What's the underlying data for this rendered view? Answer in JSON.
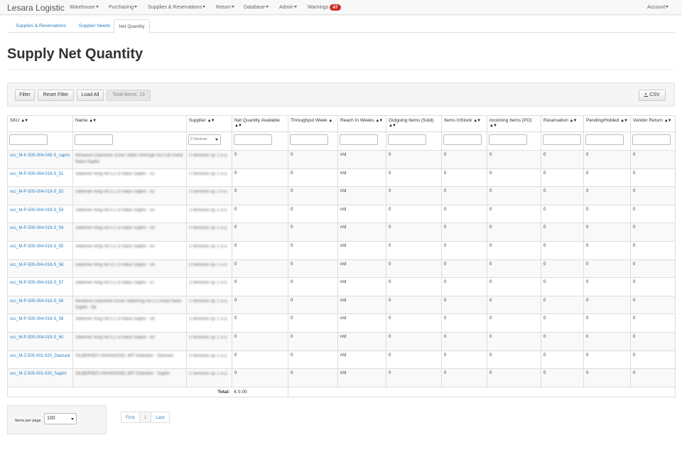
{
  "app": {
    "brand": "Lesara Logistic",
    "nav": [
      {
        "label": "Warehouse"
      },
      {
        "label": "Purchasing"
      },
      {
        "label": "Supplies & Reservations"
      },
      {
        "label": "Return"
      },
      {
        "label": "Database"
      },
      {
        "label": "Admin"
      }
    ],
    "warnings_label": "Warnings",
    "warnings_count": "47",
    "account_label": "Account",
    "badge_color": "#c9302c",
    "link_color": "#2a7fc2"
  },
  "tabs": [
    {
      "label": "Supplies & Reservations",
      "active": false
    },
    {
      "label": "Supplier Needs",
      "active": false
    },
    {
      "label": "Net Quantity",
      "active": true
    }
  ],
  "page": {
    "title": "Supply Net Quantity"
  },
  "toolbar": {
    "filter": "Filter",
    "reset": "Reset Filter",
    "load_all": "Load All",
    "total_items": "Total Items: 13",
    "csv": "CSV",
    "csv_icon": "download-icon"
  },
  "table": {
    "columns": [
      {
        "label": "SKU",
        "sort": "▲▼"
      },
      {
        "label": "Name",
        "sort": "▲▼"
      },
      {
        "label": "Supplier",
        "sort": "▲▼"
      },
      {
        "label": "Net Quantity Available",
        "sort": "▲▼"
      },
      {
        "label": "Throughput Week",
        "sort": "▲"
      },
      {
        "label": "Reach In Weeks",
        "sort": "▲▼"
      },
      {
        "label": "Outgoing Items (Sold)",
        "sort": "▲▼"
      },
      {
        "label": "Items InStock",
        "sort": "▲▼"
      },
      {
        "label": "Incoming Items (PO)",
        "sort": "▲▼"
      },
      {
        "label": "Reservation",
        "sort": "▲▼"
      },
      {
        "label": "Pending/Holded",
        "sort": "▲▼"
      },
      {
        "label": "Vendor Return",
        "sort": "▲▼"
      }
    ],
    "supplier_filter": "3 Venture",
    "rows": [
      {
        "sku": "vcc_M-K-505-004-045-S_capric",
        "name": "Miniature Diamonds 925er Silber Ohrringe mit 0,40 Karat Natur-Saphir",
        "supplier": "3 Ventures sp. z o.o.",
        "values": [
          "0",
          "0",
          "n/d",
          "0",
          "0",
          "0",
          "0",
          "0",
          "0"
        ]
      },
      {
        "sku": "vcc_M-P-505-004-019-S_51",
        "name": "Silberner Ring mit 0,1 ct Natur-Saphir - 51",
        "supplier": "3 Ventures sp. z o.o.",
        "values": [
          "0",
          "0",
          "n/d",
          "0",
          "0",
          "0",
          "0",
          "0",
          "0"
        ]
      },
      {
        "sku": "vcc_M-P-505-004-019-S_52",
        "name": "Silberner Ring mit 0,1 ct Natur-Saphir - 52",
        "supplier": "3 Ventures sp. z o.o.",
        "values": [
          "0",
          "0",
          "n/d",
          "0",
          "0",
          "0",
          "0",
          "0",
          "0"
        ]
      },
      {
        "sku": "vcc_M-P-505-004-019-S_53",
        "name": "Silberner Ring mit 0,1 ct Natur-Saphir - 53",
        "supplier": "3 Ventures sp. z o.o.",
        "values": [
          "0",
          "0",
          "n/d",
          "0",
          "0",
          "0",
          "0",
          "0",
          "0"
        ]
      },
      {
        "sku": "vcc_M-P-505-004-019-S_54",
        "name": "Silberner Ring mit 0,1 ct Natur-Saphir - 54",
        "supplier": "3 Ventures sp. z o.o.",
        "values": [
          "0",
          "0",
          "n/d",
          "0",
          "0",
          "0",
          "0",
          "0",
          "0"
        ]
      },
      {
        "sku": "vcc_M-P-505-004-019-S_55",
        "name": "Silberner Ring mit 0,1 ct Natur-Saphir - 55",
        "supplier": "3 Ventures sp. z o.o.",
        "values": [
          "0",
          "0",
          "n/d",
          "0",
          "0",
          "0",
          "0",
          "0",
          "0"
        ]
      },
      {
        "sku": "vcc_M-P-505-004-019-S_56",
        "name": "Silberner Ring mit 0,1 ct Natur-Saphir - 56",
        "supplier": "3 Ventures sp. z o.o.",
        "values": [
          "0",
          "0",
          "n/d",
          "0",
          "0",
          "0",
          "0",
          "0",
          "0"
        ]
      },
      {
        "sku": "vcc_M-P-505-004-019-S_57",
        "name": "Silberner Ring mit 0,1 ct Natur-Saphir - 57",
        "supplier": "3 Ventures sp. z o.o.",
        "values": [
          "0",
          "0",
          "n/d",
          "0",
          "0",
          "0",
          "0",
          "0",
          "0"
        ]
      },
      {
        "sku": "vcc_M-P-505-004-019-S_58",
        "name": "Miniature Diamonds 925er Silberring mit 0,1 Karat Natur-Saphir - 58",
        "supplier": "3 Ventures sp. z o.o.",
        "values": [
          "0",
          "0",
          "n/d",
          "0",
          "0",
          "0",
          "0",
          "0",
          "0"
        ]
      },
      {
        "sku": "vcc_M-P-505-004-019-S_59",
        "name": "Silberner Ring mit 0,1 ct Natur-Saphir - 59",
        "supplier": "3 Ventures sp. z o.o.",
        "values": [
          "0",
          "0",
          "n/d",
          "0",
          "0",
          "0",
          "0",
          "0",
          "0"
        ]
      },
      {
        "sku": "vcc_M-P-505-004-019-S_60",
        "name": "Silberner Ring mit 0,1 ct Natur-Saphir - 60",
        "supplier": "3 Ventures sp. z o.o.",
        "values": [
          "0",
          "0",
          "n/d",
          "0",
          "0",
          "0",
          "0",
          "0",
          "0"
        ]
      },
      {
        "sku": "vcc_M-Z-505-001-020_Diamant",
        "name": "SILBERNES ANHÄNGSEL MIT Edelstein - Diamant",
        "supplier": "3 Ventures sp. z o.o.",
        "values": [
          "0",
          "0",
          "n/d",
          "0",
          "0",
          "0",
          "0",
          "0",
          "0"
        ]
      },
      {
        "sku": "vcc_M-Z-505-001-020_Saphir",
        "name": "SILBERNES ANHÄNGSEL MIT Edelstein - Saphir",
        "supplier": "3 Ventures sp. z o.o.",
        "values": [
          "0",
          "0",
          "n/d",
          "0",
          "0",
          "0",
          "0",
          "0",
          "0"
        ]
      }
    ],
    "total_label": "Total:",
    "total_value": "€ 0.00"
  },
  "pagination": {
    "items_per_page_label": "Items per page",
    "items_per_page": "100",
    "first": "First",
    "current": "1",
    "last": "Last"
  }
}
